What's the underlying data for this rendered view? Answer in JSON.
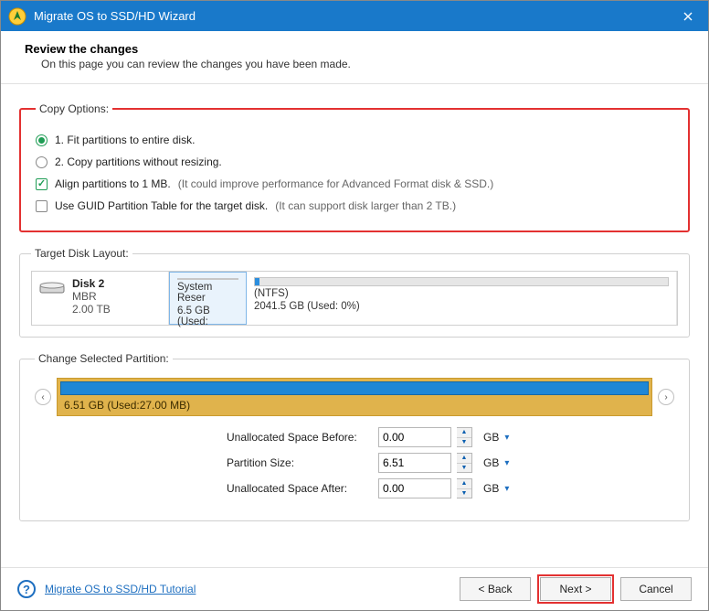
{
  "window": {
    "title": "Migrate OS to SSD/HD Wizard"
  },
  "header": {
    "title": "Review the changes",
    "subtitle": "On this page you can review the changes you have been made."
  },
  "copy_options": {
    "legend": "Copy Options:",
    "opt1": "1. Fit partitions to entire disk.",
    "opt2": "2. Copy partitions without resizing.",
    "align_label": "Align partitions to 1 MB.",
    "align_hint": "(It could improve performance for Advanced Format disk & SSD.)",
    "gpt_label": "Use GUID Partition Table for the target disk.",
    "gpt_hint": "(It can support disk larger than 2 TB.)"
  },
  "disk_layout": {
    "legend": "Target Disk Layout:",
    "disk": {
      "name": "Disk 2",
      "type": "MBR",
      "size": "2.00 TB"
    },
    "partitions": [
      {
        "label": "System Reser",
        "size_line": "6.5 GB (Used:"
      },
      {
        "label": "(NTFS)",
        "size_line": "2041.5 GB (Used: 0%)"
      }
    ]
  },
  "change_partition": {
    "legend": "Change Selected Partition:",
    "summary": "6.51 GB (Used:27.00 MB)",
    "rows": {
      "before": {
        "label": "Unallocated Space Before:",
        "value": "0.00",
        "unit": "GB"
      },
      "size": {
        "label": "Partition Size:",
        "value": "6.51",
        "unit": "GB"
      },
      "after": {
        "label": "Unallocated Space After:",
        "value": "0.00",
        "unit": "GB"
      }
    }
  },
  "footer": {
    "help_link": "Migrate OS to SSD/HD Tutorial",
    "back": "< Back",
    "next": "Next >",
    "cancel": "Cancel"
  },
  "colors": {
    "accent": "#1979ca",
    "danger_outline": "#e33131",
    "slider_bg": "#e0b34c",
    "slider_fill": "#1e87d6",
    "green": "#1f9d55"
  }
}
